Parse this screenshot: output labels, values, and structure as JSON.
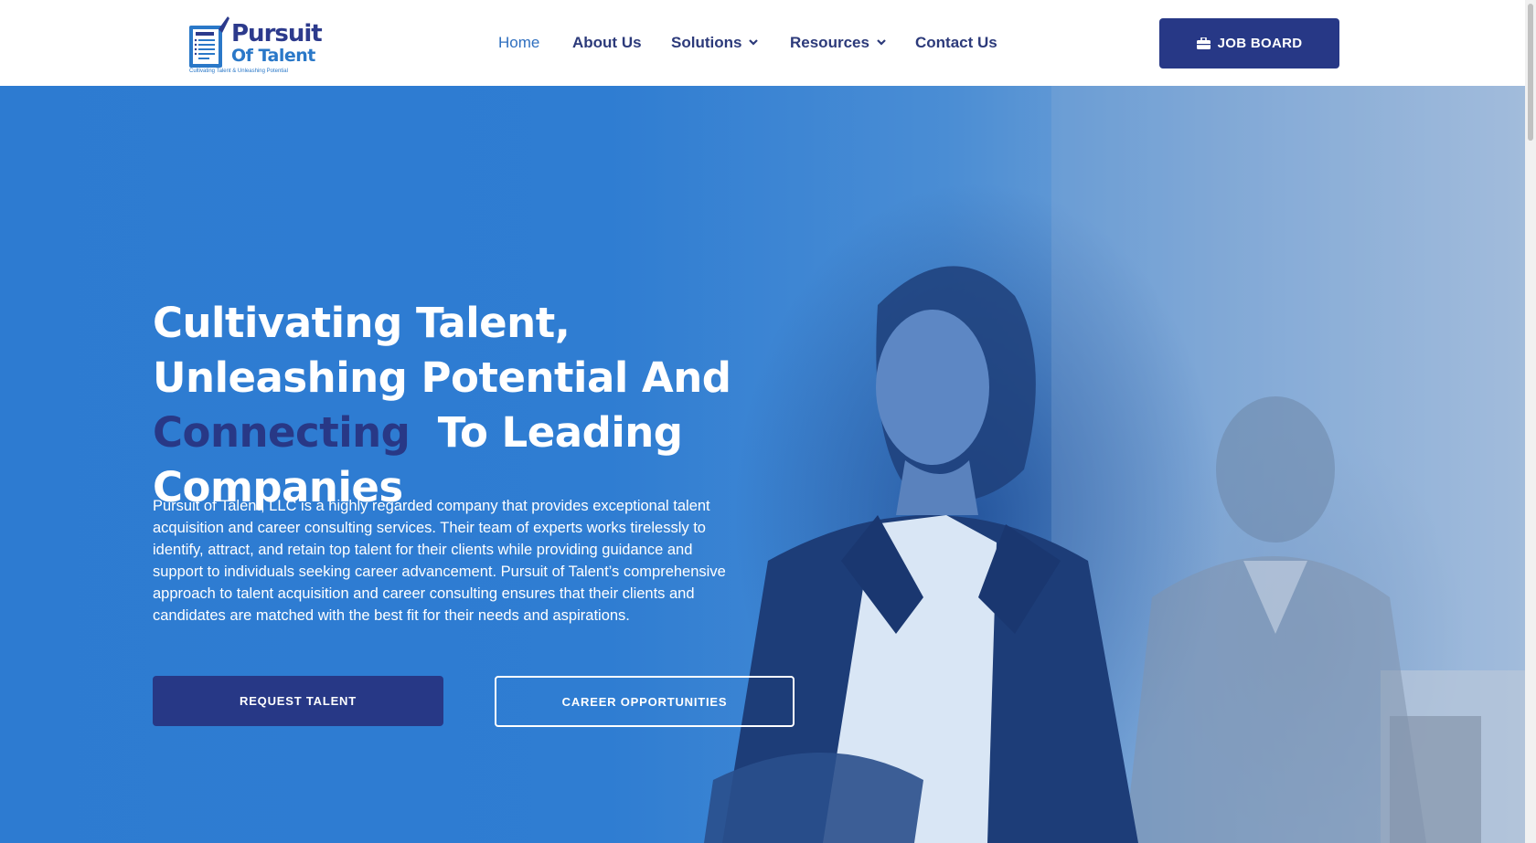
{
  "brand": {
    "name_line1": "Pursuit",
    "name_line2": "Of Talent",
    "tagline": "Cultivating Talent & Unleashing Potential",
    "doc_label": "RESUME",
    "colors": {
      "navy": "#273886",
      "blue": "#2a78c8",
      "hero_blue": "#2f7dd2"
    }
  },
  "nav": {
    "items": [
      {
        "label": "Home",
        "active": true
      },
      {
        "label": "About Us"
      },
      {
        "label": "Solutions",
        "dropdown": true
      },
      {
        "label": "Resources",
        "dropdown": true
      },
      {
        "label": "Contact Us"
      }
    ],
    "job_board": {
      "label": "JOB BOARD",
      "icon": "briefcase-icon"
    }
  },
  "hero": {
    "headline": {
      "part1": "Cultivating Talent, Unleashing Potential And ",
      "highlight": "Connecting",
      "part2": "  To Leading Companies"
    },
    "paragraph": "Pursuit of Talent, LLC is a highly regarded company that provides exceptional talent acquisition and career consulting services. Their team of experts works tirelessly to identify, attract, and retain top talent for their clients while providing guidance and support to individuals seeking career advancement. Pursuit of Talent’s comprehensive approach to talent acquisition and career consulting ensures that their clients and candidates are matched with the best fit for their needs and aspirations.",
    "primary_button": "REQUEST TALENT",
    "secondary_button": "CAREER OPPORTUNITIES"
  }
}
